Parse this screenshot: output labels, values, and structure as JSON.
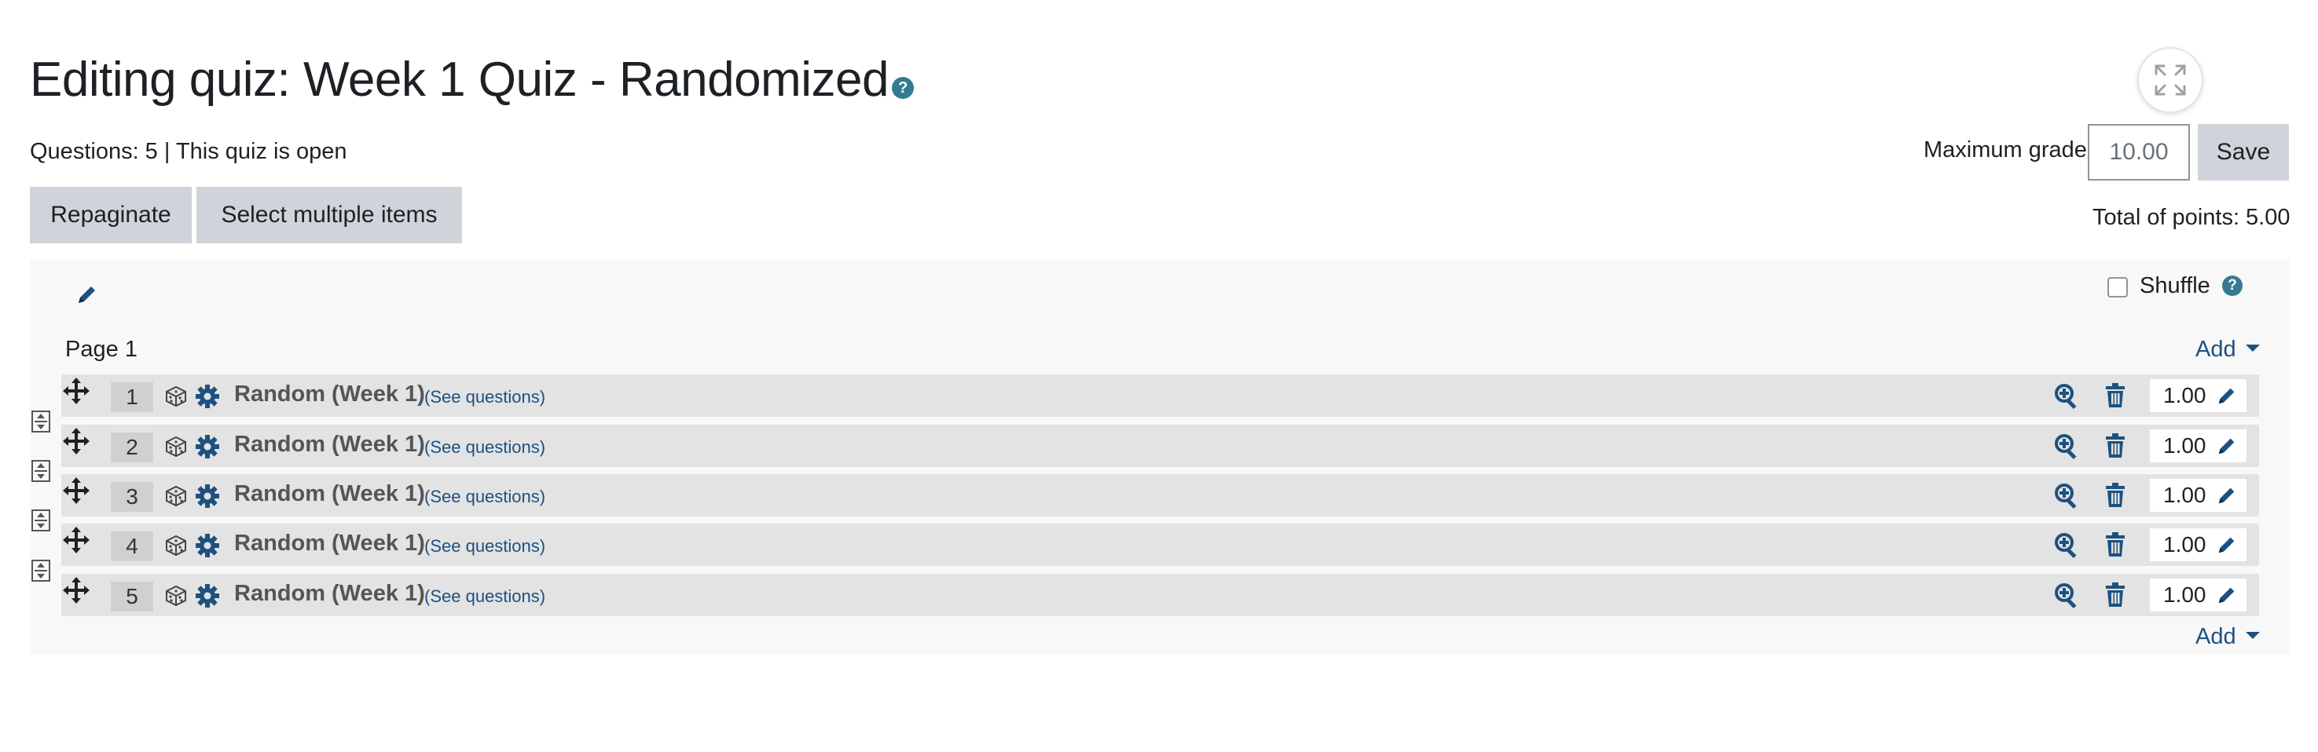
{
  "header": {
    "title": "Editing quiz: Week 1 Quiz - Randomized",
    "help_glyph": "?",
    "status": "Questions: 5 | This quiz is open"
  },
  "grading": {
    "max_grade_label": "Maximum grade",
    "max_grade_value": "10.00",
    "save_label": "Save",
    "total_points": "Total of points: 5.00"
  },
  "toolbar": {
    "repaginate_label": "Repaginate",
    "select_multiple_label": "Select multiple items"
  },
  "section": {
    "shuffle_label": "Shuffle",
    "shuffle_checked": false,
    "page_heading": "Page 1",
    "add_label": "Add",
    "questions": [
      {
        "slot": "1",
        "name": "Random (Week 1)",
        "see": "(See questions)",
        "mark": "1.00"
      },
      {
        "slot": "2",
        "name": "Random (Week 1)",
        "see": "(See questions)",
        "mark": "1.00"
      },
      {
        "slot": "3",
        "name": "Random (Week 1)",
        "see": "(See questions)",
        "mark": "1.00"
      },
      {
        "slot": "4",
        "name": "Random (Week 1)",
        "see": "(See questions)",
        "mark": "1.00"
      },
      {
        "slot": "5",
        "name": "Random (Week 1)",
        "see": "(See questions)",
        "mark": "1.00"
      }
    ]
  },
  "icons": {
    "section_edit": "pencil-icon",
    "fullscreen": "expand-icon",
    "move": "move-arrows-icon",
    "random": "dice-icon",
    "settings": "gear-icon",
    "preview": "zoom-in-icon",
    "delete": "trash-icon",
    "mark_edit": "pencil-icon",
    "page_break": "page-break-icon"
  },
  "colors": {
    "link": "#1d5180",
    "help_badge": "#357a91",
    "button_bg": "#ced4da",
    "row_bg": "#e3e3e3",
    "section_bg": "#f8f8f8"
  }
}
